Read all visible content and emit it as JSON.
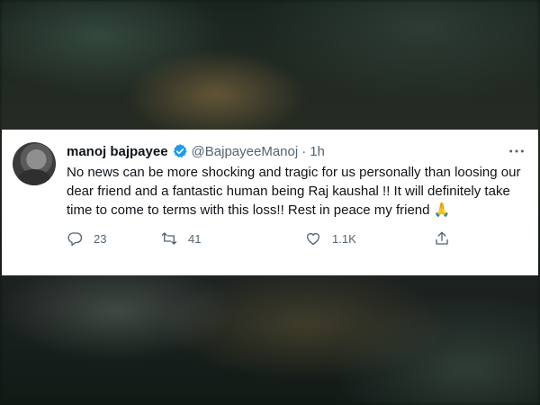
{
  "tweet": {
    "display_name": "manoj bajpayee",
    "handle": "@BajpayeeManoj",
    "separator": "·",
    "time": "1h",
    "text": "No news can be more shocking and tragic for us personally than loosing our dear friend and a fantastic human being Raj kaushal !! It will definitely take time to come to terms with this loss!! Rest in peace my friend",
    "emoji": "🙏",
    "verified": true
  },
  "actions": {
    "reply_count": "23",
    "retweet_count": "41",
    "like_count": "1.1K"
  },
  "icons": {
    "verified": "verified-badge-icon",
    "more": "more-options-icon",
    "reply": "reply-icon",
    "retweet": "retweet-icon",
    "like": "heart-icon",
    "share": "share-icon"
  },
  "colors": {
    "verified_blue": "#1d9bf0",
    "text": "#0f1419",
    "muted": "#536471"
  }
}
